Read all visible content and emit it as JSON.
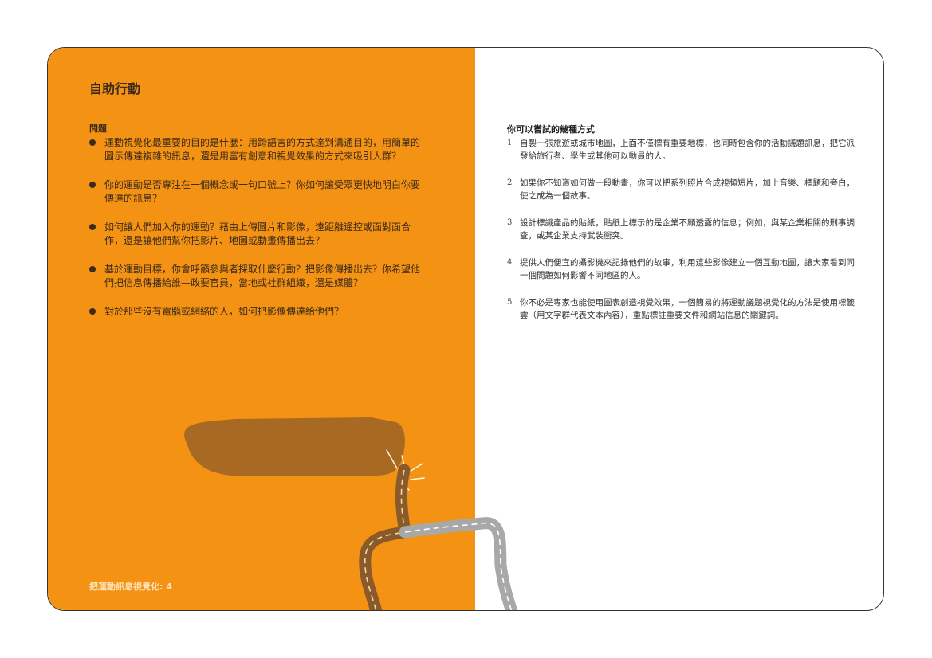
{
  "page": {
    "title": "自助行動",
    "footer": "把運動訊息視覺化: 4"
  },
  "questions": {
    "heading": "問題",
    "items": [
      "運動視覺化最重要的目的是什麼：用跨語言的方式達到溝通目的，用簡單的圖示傳達複雜的訊息，還是用富有創意和視覺效果的方式來吸引人群？",
      "你的運動是否專注在一個概念或一句口號上？你如何讓受眾更快地明白你要傳達的訊息？",
      "如何讓人們加入你的運動？藉由上傳圖片和影像，遠距離遙控或面對面合作，還是讓他們幫你把影片、地圖或動畫傳播出去？",
      "基於運動目標，你會呼籲參與者採取什麼行動？把影像傳播出去？你希望他們把信息傳播給誰—政要官員，當地或社群組織，還是媒體？",
      "對於那些沒有電腦或網絡的人，如何把影像傳達給他們？"
    ]
  },
  "ways": {
    "heading": "你可以嘗試的幾種方式",
    "items": [
      {
        "num": "1",
        "text": "自製一張旅遊或城市地圖，上面不僅標有重要地標，也同時包含你的活動議題訊息，把它派發給旅行者、學生或其他可以動員的人。"
      },
      {
        "num": "2",
        "text": "如果你不知道如何做一段動畫，你可以把系列照片合成視頻短片，加上音樂、標題和旁白，使之成為一個故事。"
      },
      {
        "num": "3",
        "text": "設計標識產品的貼紙，貼紙上標示的是企業不願透露的信息；例如，與某企業相關的刑事調查，或某企業支持武裝衝突。"
      },
      {
        "num": "4",
        "text": "提供人們便宜的攝影機來記錄他們的故事，利用這些影像建立一個互動地圖，讓大家看到同一個問題如何影響不同地區的人。"
      },
      {
        "num": "5",
        "text": "你不必是專家也能使用圖表創造視覺效果，一個簡易的將運動議題視覺化的方法是使用標籤雲（用文字群代表文本內容），重點標註重要文件和網站信息的關鍵詞。"
      }
    ]
  },
  "colors": {
    "orange_panel": "#f49214",
    "finger_shape": "#a86a23",
    "brown_road": "#8a5a2b",
    "gray_road": "#a8a8a8"
  },
  "illustration": {
    "icons": [
      "pointing-finger-icon",
      "spark-icon",
      "road-path-icon"
    ]
  }
}
